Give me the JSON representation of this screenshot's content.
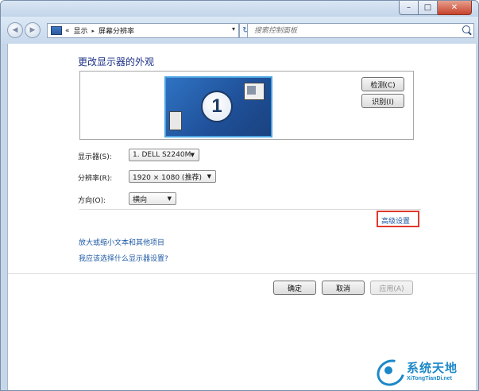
{
  "window": {
    "min_glyph": "–",
    "max_glyph": "□",
    "close_glyph": "✕"
  },
  "nav": {
    "back_glyph": "◀",
    "forward_glyph": "▶",
    "breadcrumb": {
      "prefix": "«",
      "seg1": "显示",
      "sep": "▸",
      "seg2": "屏幕分辨率",
      "dropdown": "▾"
    },
    "refresh_glyph": "↻",
    "search_placeholder": "搜索控制面板"
  },
  "page": {
    "title": "更改显示器的外观",
    "monitor_number": "1",
    "detect_button": "检测(C)",
    "identify_button": "识别(I)",
    "display_label": "显示器(S):",
    "display_value": "1. DELL S2240M",
    "resolution_label": "分辨率(R):",
    "resolution_value": "1920 × 1080 (推荐)",
    "orientation_label": "方向(O):",
    "orientation_value": "横向",
    "advanced_link": "高级设置",
    "link_enlarge": "放大或缩小文本和其他项目",
    "link_help": "我应该选择什么显示器设置?",
    "ok_button": "确定",
    "cancel_button": "取消",
    "apply_button": "应用(A)"
  },
  "watermark": {
    "name_cn": "系统天地",
    "name_en": "XiTongTianDi.net"
  },
  "colors": {
    "accent": "#1f5aa5",
    "highlight": "#e03a2e",
    "title": "#1e3287"
  }
}
